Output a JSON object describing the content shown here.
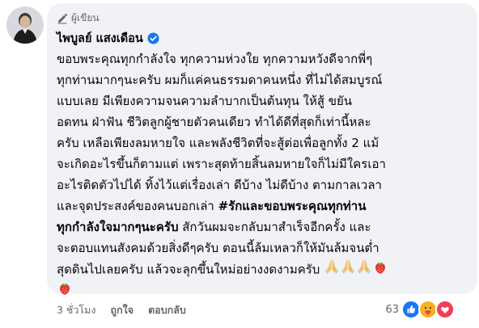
{
  "comment": {
    "author_badge": "ผู้เขียน",
    "author_name": "ไพบูลย์ แสงเดือน",
    "lines": [
      [
        {
          "t": "ขอบพระคุณทุกกำลังใจ ทุกความห่วงใย ทุกความหวังดีจากพี่ๆ",
          "b": false
        }
      ],
      [
        {
          "t": "ทุกท่านมากๆนะครับ ผมก็แค่คนธรรมดาคนหนึ่ง ที่ไม่ได้สมบูรณ์",
          "b": false
        }
      ],
      [
        {
          "t": "แบบเลย มีเพียงความจนความลำบากเป็นต้นทุน ให้สู้ ขยัน",
          "b": false
        }
      ],
      [
        {
          "t": "อดทน ฝ่าฟัน ชีวิตลูกผู้ชายตัวคนเดียว ทำได้ดีที่สุดก็เท่านี้หละ",
          "b": false
        }
      ],
      [
        {
          "t": "ครับ เหลือเพียงลมหายใจ และพลังชีวิตที่จะสู้ต่อเพื่อลูกทั้ง 2 แม้",
          "b": false
        }
      ],
      [
        {
          "t": "จะเกิดอะไรขึ้นก็ตามแต่ เพราะสุดท้ายสิ้นลมหายใจก็ไม่มีใครเอา",
          "b": false
        }
      ],
      [
        {
          "t": "อะไรติดตัวไปได้ ทิ้งไว้แต่เรื่องเล่า ดีบ้าง ไม่ดีบ้าง ตามกาลเวลา",
          "b": false
        }
      ],
      [
        {
          "t": "และจุดประสงค์ของคนบอกเล่า ",
          "b": false
        },
        {
          "t": "#รักและขอบพระคุณทุกท่าน",
          "b": true
        }
      ],
      [
        {
          "t": "ทุกกำลังใจมากๆนะครับ",
          "b": true
        },
        {
          "t": " สักวันผมจะกลับมาสำเร็จอีกครั้ง และ",
          "b": false
        }
      ],
      [
        {
          "t": "จะตอบแทนสังคมด้วยสิ่งดีๆครับ ตอนนี้ล้มเหลวก็ให้มันล้มจนต่ำ",
          "b": false
        }
      ],
      [
        {
          "t": "สุดดินไปเลยครับ แล้วจะลุกขึ้นใหม่อย่างงดงามครับ ",
          "b": false
        }
      ]
    ],
    "trailing_emojis_line1": [
      "folded-hands",
      "folded-hands",
      "folded-hands",
      "strawberry"
    ],
    "trailing_emojis_line2": [
      "strawberry"
    ]
  },
  "actions": {
    "time": "3 ชั่วโมง",
    "like": "ถูกใจ",
    "reply": "ตอบกลับ"
  },
  "reactions": {
    "count": "63",
    "types": [
      "like",
      "care",
      "love"
    ]
  },
  "colors": {
    "bubble": "#f0f2f5",
    "like_blue": "#1877f2",
    "love_red": "#f33e58",
    "care_yellow": "#f7b125",
    "muted": "#65676b"
  }
}
